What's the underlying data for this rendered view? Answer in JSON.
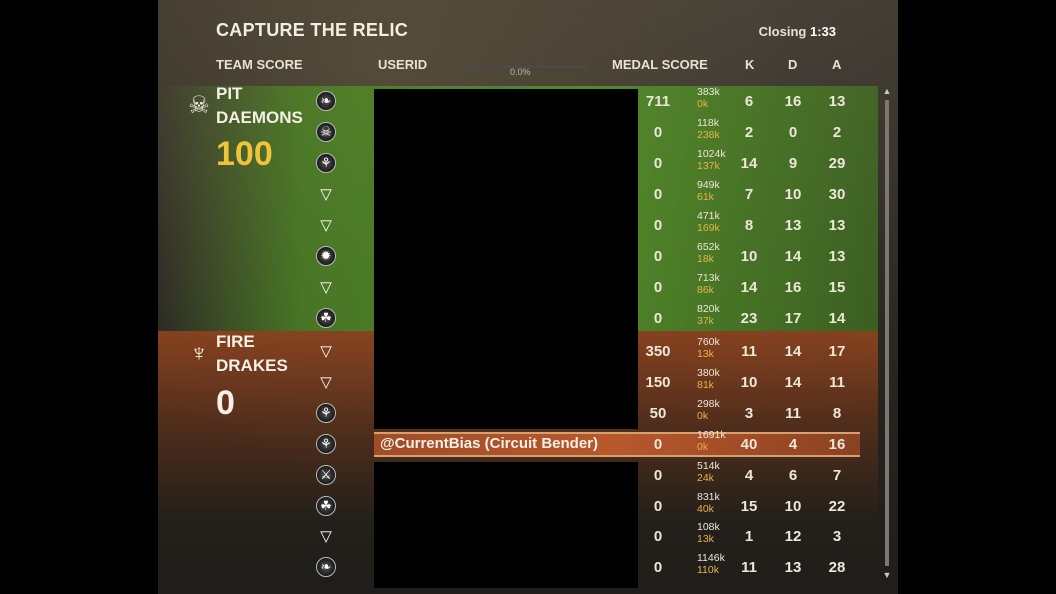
{
  "header": {
    "title": "CAPTURE THE RELIC",
    "closing_label": "Closing",
    "closing_time": "1:33"
  },
  "columns": {
    "team_score": "TEAM SCORE",
    "userid": "USERID",
    "medal_score": "MEDAL SCORE",
    "k": "K",
    "d": "D",
    "a": "A"
  },
  "progress_text": "0.0%",
  "teams": [
    {
      "name_line1": "PIT",
      "name_line2": "DAEMONS",
      "score": "100",
      "icon": "skull-icon",
      "color": "#f0c43a"
    },
    {
      "name_line1": "FIRE",
      "name_line2": "DRAKES",
      "score": "0",
      "icon": "dragon-icon",
      "color": "#f5f0e6"
    }
  ],
  "players": [
    {
      "class_icon": "dragon-head-icon",
      "glyph": "❧",
      "userid": "",
      "medal": "711",
      "dmg": "383k",
      "heal": "0k",
      "k": "6",
      "d": "16",
      "a": "13"
    },
    {
      "class_icon": "skull-emblem-icon",
      "glyph": "☠",
      "userid": "",
      "medal": "0",
      "dmg": "118k",
      "heal": "238k",
      "k": "2",
      "d": "0",
      "a": "2"
    },
    {
      "class_icon": "nature-emblem-icon",
      "glyph": "⚘",
      "userid": "",
      "medal": "0",
      "dmg": "1024k",
      "heal": "137k",
      "k": "14",
      "d": "9",
      "a": "29"
    },
    {
      "class_icon": "triangle-emblem-icon",
      "glyph": "▽",
      "userid": "",
      "medal": "0",
      "dmg": "949k",
      "heal": "61k",
      "k": "7",
      "d": "10",
      "a": "30"
    },
    {
      "class_icon": "triangle-emblem-icon",
      "glyph": "▽",
      "userid": "",
      "medal": "0",
      "dmg": "471k",
      "heal": "169k",
      "k": "8",
      "d": "13",
      "a": "13"
    },
    {
      "class_icon": "starburst-emblem-icon",
      "glyph": "✹",
      "userid": "",
      "medal": "0",
      "dmg": "652k",
      "heal": "18k",
      "k": "10",
      "d": "14",
      "a": "13"
    },
    {
      "class_icon": "triangle-emblem-icon",
      "glyph": "▽",
      "userid": "",
      "medal": "0",
      "dmg": "713k",
      "heal": "86k",
      "k": "14",
      "d": "16",
      "a": "15"
    },
    {
      "class_icon": "paw-emblem-icon",
      "glyph": "☘",
      "userid": "",
      "medal": "0",
      "dmg": "820k",
      "heal": "37k",
      "k": "23",
      "d": "17",
      "a": "14"
    },
    {
      "class_icon": "triangle-emblem-icon",
      "glyph": "▽",
      "userid": "",
      "medal": "350",
      "dmg": "760k",
      "heal": "13k",
      "k": "11",
      "d": "14",
      "a": "17"
    },
    {
      "class_icon": "triangle-emblem-icon",
      "glyph": "▽",
      "userid": "",
      "medal": "150",
      "dmg": "380k",
      "heal": "81k",
      "k": "10",
      "d": "14",
      "a": "11"
    },
    {
      "class_icon": "nature-emblem-icon",
      "glyph": "⚘",
      "userid": "",
      "medal": "50",
      "dmg": "298k",
      "heal": "0k",
      "k": "3",
      "d": "11",
      "a": "8"
    },
    {
      "class_icon": "nature-emblem-icon",
      "glyph": "⚘",
      "userid": "@CurrentBias (Circuit Bender)",
      "medal": "0",
      "dmg": "1691k",
      "heal": "0k",
      "k": "40",
      "d": "4",
      "a": "16"
    },
    {
      "class_icon": "sword-emblem-icon",
      "glyph": "⚔",
      "userid": "",
      "medal": "0",
      "dmg": "514k",
      "heal": "24k",
      "k": "4",
      "d": "6",
      "a": "7"
    },
    {
      "class_icon": "paw-emblem-icon",
      "glyph": "☘",
      "userid": "",
      "medal": "0",
      "dmg": "831k",
      "heal": "40k",
      "k": "15",
      "d": "10",
      "a": "22"
    },
    {
      "class_icon": "triangle-emblem-icon",
      "glyph": "▽",
      "userid": "",
      "medal": "0",
      "dmg": "108k",
      "heal": "13k",
      "k": "1",
      "d": "12",
      "a": "3"
    },
    {
      "class_icon": "dragon-head-icon",
      "glyph": "❧",
      "userid": "",
      "medal": "0",
      "dmg": "1146k",
      "heal": "110k",
      "k": "11",
      "d": "13",
      "a": "28"
    }
  ],
  "scroll": {
    "up_icon": "scroll-up-icon",
    "down_icon": "scroll-down-icon"
  }
}
